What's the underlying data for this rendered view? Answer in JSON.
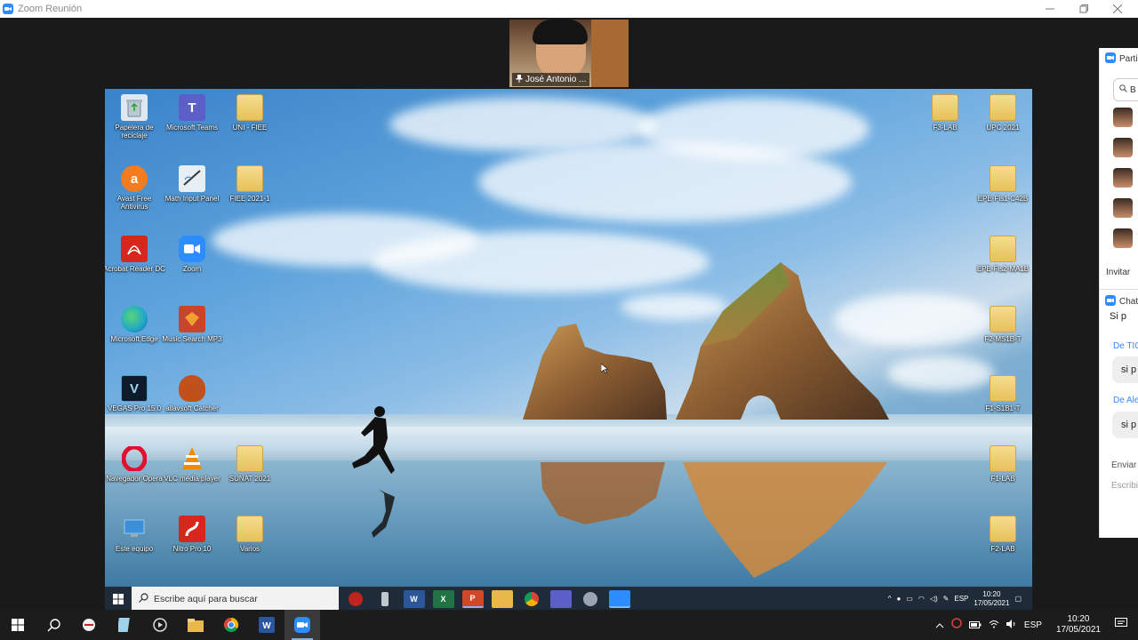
{
  "window": {
    "title": "Zoom Reunión",
    "minimize_icon": "minimize-icon",
    "maximize_icon": "maximize-icon",
    "close_icon": "close-icon"
  },
  "video": {
    "name": "José Antonio ..."
  },
  "desktop": {
    "icons_left": [
      {
        "label": "Papelera de reciclaje",
        "icon": "recycle-bin-icon",
        "color": "#d8e4ee"
      },
      {
        "label": "Microsoft Teams",
        "icon": "teams-icon",
        "color": "#5b5fc7"
      },
      {
        "label": "UNI - FIEE",
        "icon": "folder-icon",
        "color": "#e7c15a"
      },
      {
        "label": "Avast Free Antivirus",
        "icon": "avast-icon",
        "color": "#f47c20"
      },
      {
        "label": "Math Input Panel",
        "icon": "math-input-icon",
        "color": "#e8eef5"
      },
      {
        "label": "FIEE 2021-1",
        "icon": "folder-icon",
        "color": "#e7c15a"
      },
      {
        "label": "Acrobat Reader DC",
        "icon": "acrobat-icon",
        "color": "#d7271d"
      },
      {
        "label": "Zoom",
        "icon": "zoom-icon",
        "color": "#2d8cff"
      },
      {
        "label": "Microsoft Edge",
        "icon": "edge-icon",
        "color": "#1fa7c9"
      },
      {
        "label": "Music Search MP3",
        "icon": "music-search-icon",
        "color": "#c8452c"
      },
      {
        "label": "VEGAS Pro 15.0",
        "icon": "vegas-icon",
        "color": "#0d1b2a"
      },
      {
        "label": "allavsoft Catcher",
        "icon": "catcher-glove-icon",
        "color": "#c0501c"
      },
      {
        "label": "Navegador Opera",
        "icon": "opera-icon",
        "color": "#e0102e"
      },
      {
        "label": "VLC media player",
        "icon": "vlc-icon",
        "color": "#f08a00"
      },
      {
        "label": "SUNAT 2021",
        "icon": "folder-icon",
        "color": "#e7c15a"
      },
      {
        "label": "Este equipo",
        "icon": "this-pc-icon",
        "color": "#3b8fd9"
      },
      {
        "label": "Nitro Pro 10",
        "icon": "nitro-icon",
        "color": "#d7271d"
      },
      {
        "label": "Varios",
        "icon": "folder-icon",
        "color": "#e7c15a"
      }
    ],
    "icons_right": [
      {
        "label": "F3-LAB",
        "icon": "folder-icon"
      },
      {
        "label": "UPC 2021",
        "icon": "folder-icon"
      },
      {
        "label": "EPE-Fis1-C42B",
        "icon": "folder-icon"
      },
      {
        "label": "EPE-Fis2-MA1B",
        "icon": "folder-icon"
      },
      {
        "label": "F2-MS1B-T",
        "icon": "folder-icon"
      },
      {
        "label": "F1-S1B1-T",
        "icon": "folder-icon"
      },
      {
        "label": "F1-LAB",
        "icon": "folder-icon"
      },
      {
        "label": "F2-LAB",
        "icon": "folder-icon"
      }
    ]
  },
  "inner_taskbar": {
    "search_placeholder": "Escribe aquí para buscar",
    "pinned": [
      "antivirus-icon",
      "usb-icon",
      "word-icon",
      "excel-icon",
      "powerpoint-icon",
      "file-explorer-icon",
      "chrome-icon",
      "teams-icon",
      "network-icon",
      "zoom-icon"
    ],
    "lang": "ESP",
    "time": "10:20",
    "date": "17/05/2021"
  },
  "side_panel": {
    "participants_title": "Parti",
    "search_text": "B",
    "invite_label": "Invitar",
    "chat_title": "Chat",
    "chat_messages": [
      {
        "from": "",
        "text": "Si p"
      },
      {
        "from": "De TIC",
        "text": "si p"
      },
      {
        "from": "De Ale",
        "text": "si p"
      }
    ],
    "send_to": "Enviar",
    "input_placeholder": "Escribi"
  },
  "outer_taskbar": {
    "pinned": [
      "start-icon",
      "search-icon",
      "antivirus-icon",
      "notepad-icon",
      "media-icon",
      "file-explorer-icon",
      "chrome-icon",
      "word-icon",
      "zoom-icon"
    ],
    "lang": "ESP",
    "time": "10:20",
    "date": "17/05/2021"
  }
}
